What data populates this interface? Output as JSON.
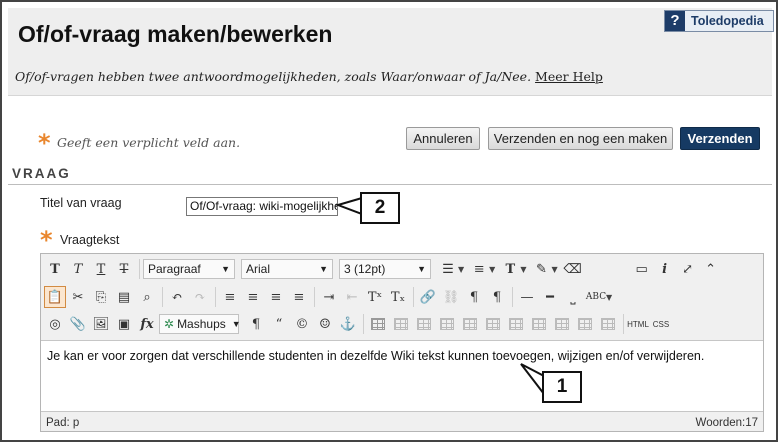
{
  "header": {
    "title": "Of/of-vraag maken/bewerken",
    "subtitle": "Of/of-vragen hebben twee antwoordmogelijkheden, zoals Waar/onwaar of Ja/Nee.",
    "help_link": "Meer Help",
    "toledopedia": {
      "icon": "?",
      "label": "Toledopedia"
    }
  },
  "required_note": {
    "star": "*",
    "text": "Geeft een verplicht veld aan."
  },
  "actions": {
    "cancel": "Annuleren",
    "submit_and_new": "Verzenden en nog een maken",
    "submit": "Verzenden"
  },
  "section": {
    "title": "VRAAG"
  },
  "question_title": {
    "label": "Titel van vraag",
    "value": "Of/Of-vraag: wiki-mogelijkhe"
  },
  "question_text": {
    "star": "*",
    "label": "Vraagtekst"
  },
  "editor": {
    "paragraph_select": "Paragraaf",
    "font_select": "Arial",
    "size_select": "3 (12pt)",
    "mashups_label": "Mashups",
    "html_label": "HTML",
    "css_label": "CSS",
    "content": "Je kan er voor zorgen dat verschillende studenten in dezelfde Wiki tekst kunnen toevoegen, wijzigen en/of verwijderen.",
    "path_label": "Pad:",
    "path_value": "p",
    "word_count_label": "Woorden:",
    "word_count_value": "17"
  },
  "callouts": {
    "one": "1",
    "two": "2"
  },
  "colors": {
    "accent_star": "#e9862d",
    "primary_button": "#163a63",
    "header_bg": "#eeeeee"
  }
}
